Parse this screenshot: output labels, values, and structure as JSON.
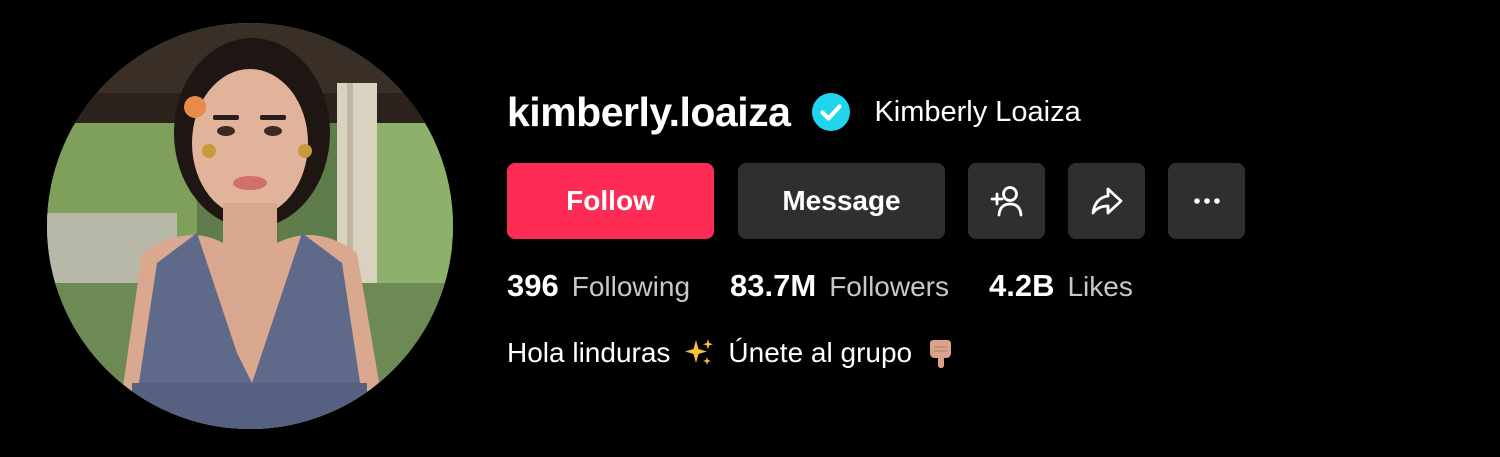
{
  "profile": {
    "username": "kimberly.loaiza",
    "display_name": "Kimberly Loaiza",
    "verified": true,
    "avatar_icon": "profile-photo"
  },
  "actions": {
    "follow_label": "Follow",
    "message_label": "Message",
    "add_friend_icon": "add-user-icon",
    "share_icon": "share-icon",
    "more_icon": "more-icon"
  },
  "stats": [
    {
      "value": "396",
      "label": "Following"
    },
    {
      "value": "83.7M",
      "label": "Followers"
    },
    {
      "value": "4.2B",
      "label": "Likes"
    }
  ],
  "bio": {
    "part1": "Hola linduras",
    "part2": "Únete al grupo",
    "emoji1": "sparkles-emoji",
    "emoji2": "pointing-down-emoji"
  },
  "colors": {
    "background": "#000000",
    "follow": "#fe2c55",
    "secondary_button": "#2f2f2f",
    "verified": "#20d5ec"
  }
}
